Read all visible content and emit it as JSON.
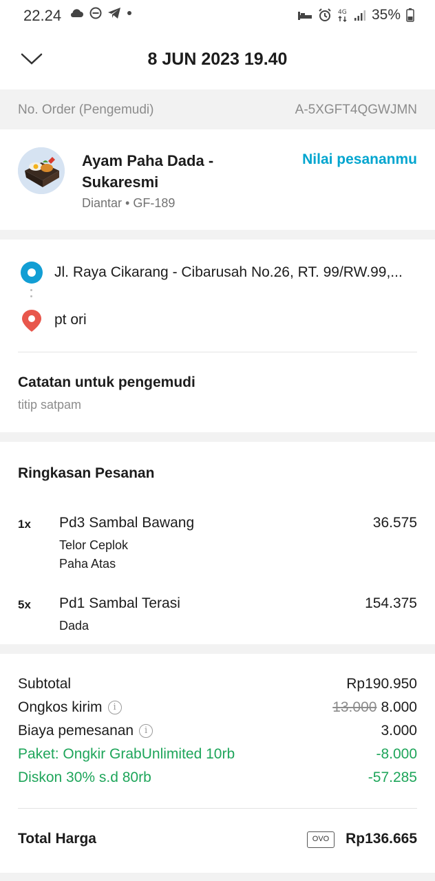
{
  "status_bar": {
    "time": "22.24",
    "network": "4G",
    "battery": "35%",
    "left_icons": [
      "cloud-icon",
      "do-not-disturb-icon",
      "telegram-icon",
      "notification-dot-icon"
    ],
    "right_icons": [
      "sleep-mode-icon",
      "alarm-icon",
      "mobile-data-icon",
      "signal-icon",
      "battery-icon"
    ]
  },
  "header": {
    "title": "8 JUN 2023 19.40",
    "back_icon": "chevron-down-icon"
  },
  "order": {
    "label": "No. Order (Pengemudi)",
    "id": "A-5XGFT4QGWJMN"
  },
  "merchant": {
    "name": "Ayam Paha Dada - Sukaresmi",
    "status": "Diantar • GF-189",
    "rate_label": "Nilai pesananmu"
  },
  "route": {
    "pickup": "Jl. Raya Cikarang - Cibarusah No.26, RT. 99/RW.99,...",
    "dropoff": "pt ori"
  },
  "driver_note": {
    "title": "Catatan untuk pengemudi",
    "text": "titip satpam"
  },
  "summary": {
    "title": "Ringkasan Pesanan",
    "items": [
      {
        "qty": "1x",
        "name": "Pd3 Sambal Bawang",
        "price": "36.575",
        "options": [
          "Telor Ceplok",
          "Paha Atas"
        ]
      },
      {
        "qty": "5x",
        "name": "Pd1 Sambal Terasi",
        "price": "154.375",
        "options": [
          "Dada"
        ]
      }
    ]
  },
  "totals": {
    "subtotal_label": "Subtotal",
    "subtotal_value": "Rp190.950",
    "delivery_label": "Ongkos kirim",
    "delivery_old": "13.000",
    "delivery_value": "8.000",
    "order_fee_label": "Biaya pemesanan",
    "order_fee_value": "3.000",
    "package_label": "Paket: Ongkir GrabUnlimited 10rb",
    "package_value": "-8.000",
    "discount_label": "Diskon 30% s.d 80rb",
    "discount_value": "-57.285",
    "total_label": "Total Harga",
    "payment_badge": "OVO",
    "total_value": "Rp136.665"
  },
  "colors": {
    "accent": "#00a5cf",
    "discount_green": "#1ea55a",
    "pickup_pin": "#129ed4",
    "dropoff_pin": "#e8574c"
  }
}
